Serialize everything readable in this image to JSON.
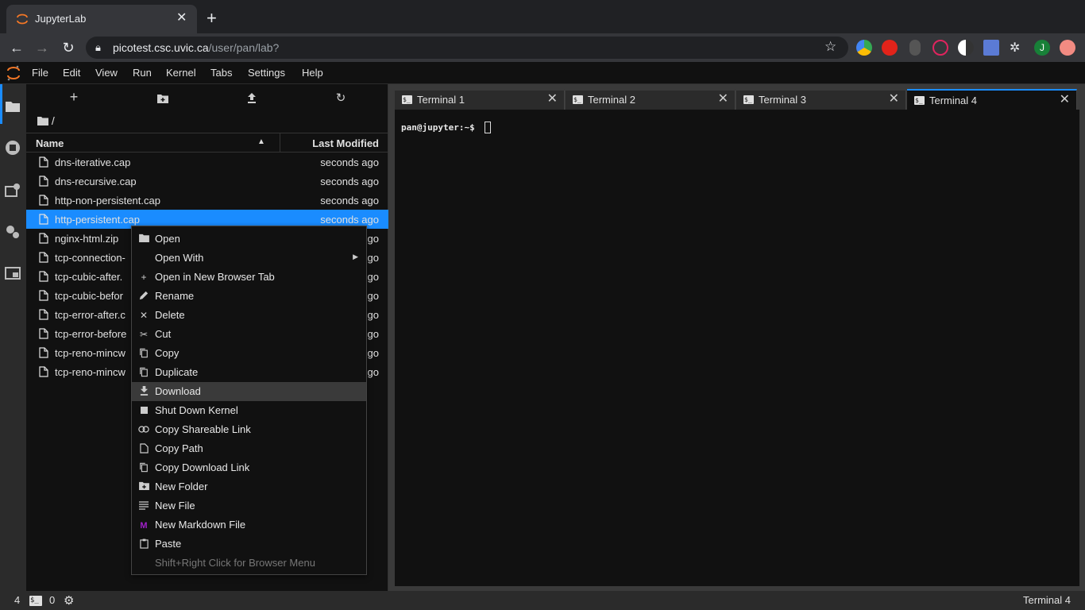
{
  "browser": {
    "tab_title": "JupyterLab",
    "url_host": "picotest.csc.uvic.ca",
    "url_path": "/user/pan/lab?",
    "profile_initial": "J"
  },
  "menubar": {
    "items": [
      "File",
      "Edit",
      "View",
      "Run",
      "Kernel",
      "Tabs",
      "Settings",
      "Help"
    ]
  },
  "filebrowser": {
    "breadcrumb": "/",
    "col_name": "Name",
    "col_modified": "Last Modified",
    "files": [
      {
        "name": "dns-iterative.cap",
        "modified": "seconds ago"
      },
      {
        "name": "dns-recursive.cap",
        "modified": "seconds ago"
      },
      {
        "name": "http-non-persistent.cap",
        "modified": "seconds ago"
      },
      {
        "name": "http-persistent.cap",
        "modified": "seconds ago"
      },
      {
        "name": "nginx-html.zip",
        "modified": "go"
      },
      {
        "name": "tcp-connection-",
        "modified": "go"
      },
      {
        "name": "tcp-cubic-after.",
        "modified": "go"
      },
      {
        "name": "tcp-cubic-befor",
        "modified": "go"
      },
      {
        "name": "tcp-error-after.c",
        "modified": "go"
      },
      {
        "name": "tcp-error-before",
        "modified": "go"
      },
      {
        "name": "tcp-reno-mincw",
        "modified": "go"
      },
      {
        "name": "tcp-reno-mincw",
        "modified": "go"
      }
    ]
  },
  "terminal": {
    "tabs": [
      "Terminal 1",
      "Terminal 2",
      "Terminal 3",
      "Terminal 4"
    ],
    "active_tab": "Terminal 4",
    "prompt": "pan@jupyter:~$"
  },
  "context_menu": {
    "items": [
      {
        "label": "Open",
        "icon": "folder-icon"
      },
      {
        "label": "Open With",
        "icon": "",
        "submenu": true
      },
      {
        "label": "Open in New Browser Tab",
        "icon": "plus-icon"
      },
      {
        "label": "Rename",
        "icon": "pencil-icon"
      },
      {
        "label": "Delete",
        "icon": "close-icon"
      },
      {
        "label": "Cut",
        "icon": "scissors-icon"
      },
      {
        "label": "Copy",
        "icon": "copy-icon"
      },
      {
        "label": "Duplicate",
        "icon": "duplicate-icon"
      },
      {
        "label": "Download",
        "icon": "download-icon"
      },
      {
        "label": "Shut Down Kernel",
        "icon": "stop-icon"
      },
      {
        "label": "Copy Shareable Link",
        "icon": "link-icon"
      },
      {
        "label": "Copy Path",
        "icon": "file-icon"
      },
      {
        "label": "Copy Download Link",
        "icon": "copy-icon"
      },
      {
        "label": "New Folder",
        "icon": "new-folder-icon"
      },
      {
        "label": "New File",
        "icon": "text-file-icon"
      },
      {
        "label": "New Markdown File",
        "icon": "markdown-icon"
      },
      {
        "label": "Paste",
        "icon": "clipboard-icon"
      },
      {
        "label": "Shift+Right Click for Browser Menu",
        "icon": "",
        "disabled": true
      }
    ],
    "highlighted": "Download"
  },
  "statusbar": {
    "terminals_count": "4",
    "kernels_count": "0",
    "active_item": "Terminal 4"
  },
  "colors": {
    "selection": "#1a8cff",
    "jupyter_orange": "#f37726",
    "markdown_purple": "#a020c8"
  }
}
